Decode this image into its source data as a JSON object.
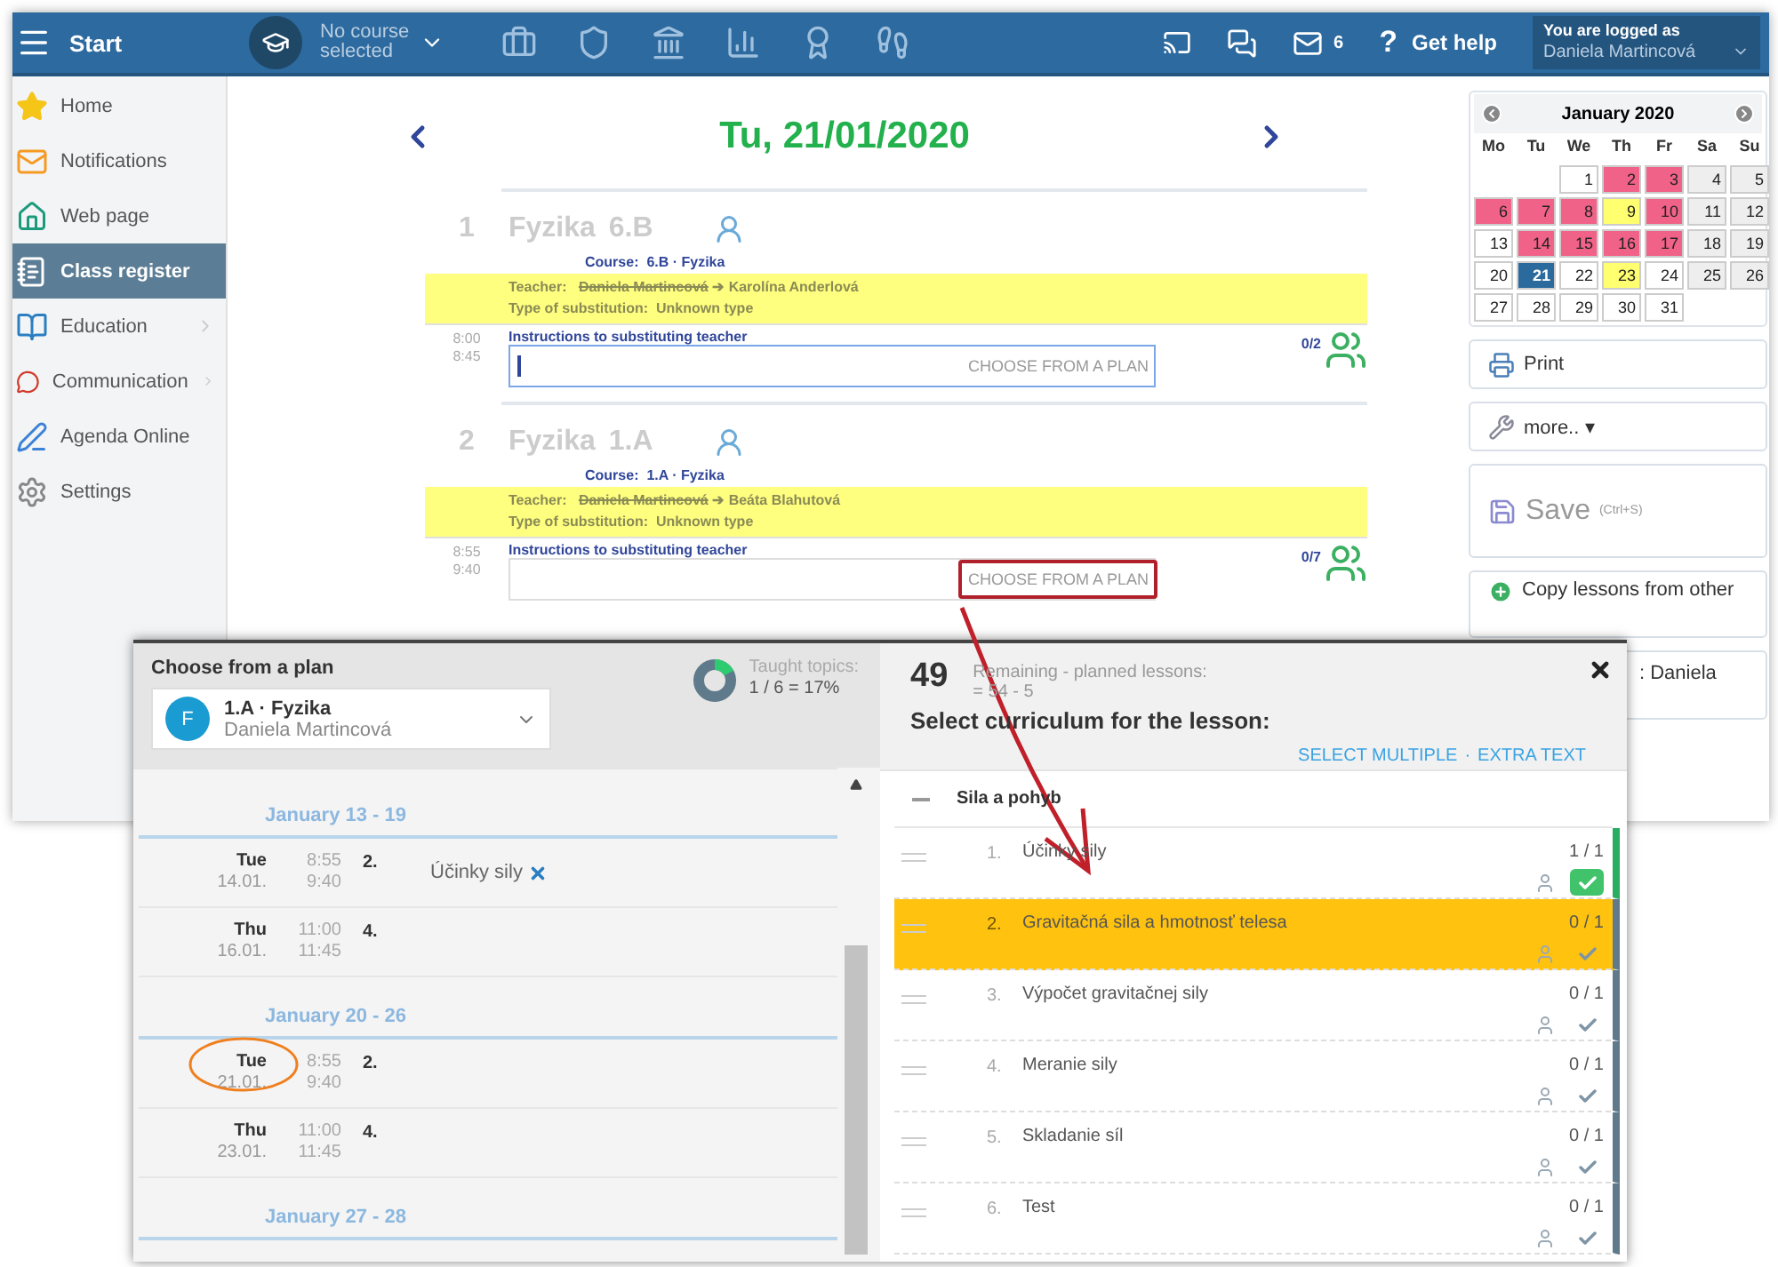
{
  "topbar": {
    "start": "Start",
    "course": [
      "No course",
      "selected"
    ],
    "mail_count": "6",
    "help_mark": "?",
    "help": "Get help",
    "user_caption": "You are logged as",
    "user_name": "Daniela Martincová"
  },
  "sidebar": {
    "items": [
      {
        "label": "Home",
        "selected": false,
        "has_submenu": false
      },
      {
        "label": "Notifications",
        "selected": false,
        "has_submenu": false
      },
      {
        "label": "Web page",
        "selected": false,
        "has_submenu": false
      },
      {
        "label": "Class register",
        "selected": true,
        "has_submenu": false
      },
      {
        "label": "Education",
        "selected": false,
        "has_submenu": true
      },
      {
        "label": "Communication",
        "selected": false,
        "has_submenu": true
      },
      {
        "label": "Agenda Online",
        "selected": false,
        "has_submenu": false
      },
      {
        "label": "Settings",
        "selected": false,
        "has_submenu": false
      }
    ]
  },
  "date_title": "Tu, 21/01/2020",
  "lessons": [
    {
      "number": "1",
      "title": "Fyzika 6.B",
      "course_label": "Course:",
      "course": "6.B · Fyzika",
      "teacher_label": "Teacher:",
      "teacher_old": "Daniela Martincová",
      "arrow": "➔",
      "teacher_new": "Karolína Anderlová",
      "type_label": "Type of substitution:",
      "type": "Unknown type",
      "start": "8:00",
      "end": "8:45",
      "instructions_label": "Instructions to substituting teacher",
      "plan_button": "CHOOSE FROM A PLAN",
      "focused": true,
      "highlighted": false,
      "attendance": "0/2"
    },
    {
      "number": "2",
      "title": "Fyzika 1.A",
      "course_label": "Course:",
      "course": "1.A · Fyzika",
      "teacher_label": "Teacher:",
      "teacher_old": "Daniela Martincová",
      "arrow": "➔",
      "teacher_new": "Beáta Blahutová",
      "type_label": "Type of substitution:",
      "type": "Unknown type",
      "start": "8:55",
      "end": "9:40",
      "instructions_label": "Instructions to substituting teacher",
      "plan_button": "CHOOSE FROM A PLAN",
      "focused": false,
      "highlighted": true,
      "attendance": "0/7"
    }
  ],
  "calendar": {
    "month": "January 2020",
    "weekdays": [
      "Mo",
      "Tu",
      "We",
      "Th",
      "Fr",
      "Sa",
      "Su"
    ],
    "days": [
      {
        "kind": "blank"
      },
      {
        "kind": "blank"
      },
      {
        "kind": "day",
        "day": "1",
        "color": "#ffffff",
        "selected": false
      },
      {
        "kind": "day",
        "day": "2",
        "color": "#f06288",
        "selected": false
      },
      {
        "kind": "day",
        "day": "3",
        "color": "#f06288",
        "selected": false
      },
      {
        "kind": "day",
        "day": "4",
        "color": "#eeeeee",
        "selected": false
      },
      {
        "kind": "day",
        "day": "5",
        "color": "#eeeeee",
        "selected": false
      },
      {
        "kind": "day",
        "day": "6",
        "color": "#f06288",
        "selected": false
      },
      {
        "kind": "day",
        "day": "7",
        "color": "#f06288",
        "selected": false
      },
      {
        "kind": "day",
        "day": "8",
        "color": "#f06288",
        "selected": false
      },
      {
        "kind": "day",
        "day": "9",
        "color": "#ffff70",
        "selected": false
      },
      {
        "kind": "day",
        "day": "10",
        "color": "#f06288",
        "selected": false
      },
      {
        "kind": "day",
        "day": "11",
        "color": "#eeeeee",
        "selected": false
      },
      {
        "kind": "day",
        "day": "12",
        "color": "#eeeeee",
        "selected": false
      },
      {
        "kind": "day",
        "day": "13",
        "color": "#ffffff",
        "selected": false
      },
      {
        "kind": "day",
        "day": "14",
        "color": "#f06288",
        "selected": false
      },
      {
        "kind": "day",
        "day": "15",
        "color": "#f06288",
        "selected": false
      },
      {
        "kind": "day",
        "day": "16",
        "color": "#f06288",
        "selected": false
      },
      {
        "kind": "day",
        "day": "17",
        "color": "#f06288",
        "selected": false
      },
      {
        "kind": "day",
        "day": "18",
        "color": "#eeeeee",
        "selected": false
      },
      {
        "kind": "day",
        "day": "19",
        "color": "#eeeeee",
        "selected": false
      },
      {
        "kind": "day",
        "day": "20",
        "color": "#ffffff",
        "selected": false
      },
      {
        "kind": "day",
        "day": "21",
        "color": "#2b6a9d",
        "selected": true
      },
      {
        "kind": "day",
        "day": "22",
        "color": "#ffffff",
        "selected": false
      },
      {
        "kind": "day",
        "day": "23",
        "color": "#ffff70",
        "selected": false
      },
      {
        "kind": "day",
        "day": "24",
        "color": "#ffffff",
        "selected": false
      },
      {
        "kind": "day",
        "day": "25",
        "color": "#eeeeee",
        "selected": false
      },
      {
        "kind": "day",
        "day": "26",
        "color": "#eeeeee",
        "selected": false
      },
      {
        "kind": "day",
        "day": "27",
        "color": "#ffffff",
        "selected": false
      },
      {
        "kind": "day",
        "day": "28",
        "color": "#ffffff",
        "selected": false
      },
      {
        "kind": "day",
        "day": "29",
        "color": "#ffffff",
        "selected": false
      },
      {
        "kind": "day",
        "day": "30",
        "color": "#ffffff",
        "selected": false
      },
      {
        "kind": "day",
        "day": "31",
        "color": "#ffffff",
        "selected": false
      }
    ]
  },
  "actions": [
    {
      "kind": "print",
      "label": "Print",
      "disabled": false
    },
    {
      "kind": "more",
      "label": "more..",
      "caret": "▾",
      "disabled": false
    },
    {
      "kind": "save",
      "label": "Save",
      "shortcut": "(Ctrl+S)",
      "disabled": true
    },
    {
      "kind": "copy",
      "label": "Copy lessons from other",
      "disabled": false
    },
    {
      "kind": "teacher",
      "label": ": Daniela",
      "disabled": false
    }
  ],
  "popup": {
    "title": "Choose from a plan",
    "plan": {
      "avatar": "F",
      "course": "1.A · Fyzika",
      "teacher": "Daniela Martincová"
    },
    "taught": {
      "label": "Taught topics:",
      "value": "1 / 6 = 17%",
      "level": 0.17
    },
    "weeks": [
      {
        "label": "January 13 - 19",
        "lessons": [
          {
            "day": "Tue",
            "date": "14.01.",
            "start": "8:55",
            "end": "9:40",
            "period": "2.",
            "topic": "Účinky sily",
            "circled": false
          },
          {
            "day": "Thu",
            "date": "16.01.",
            "start": "11:00",
            "end": "11:45",
            "period": "4.",
            "circled": false
          }
        ]
      },
      {
        "label": "January 20 - 26",
        "lessons": [
          {
            "day": "Tue",
            "date": "21.01.",
            "start": "8:55",
            "end": "9:40",
            "period": "2.",
            "circled": true
          },
          {
            "day": "Thu",
            "date": "23.01.",
            "start": "11:00",
            "end": "11:45",
            "period": "4.",
            "circled": false
          }
        ]
      },
      {
        "label": "January 27 - 28"
      }
    ],
    "count": "49",
    "remaining": "Remaining - planned lessons:",
    "formula": "= 54 - 5",
    "heading": "Select curriculum for the lesson:",
    "links": [
      "SELECT MULTIPLE",
      "EXTRA TEXT"
    ],
    "link_separator": "·",
    "group": "Sila a pohyb",
    "topics": [
      {
        "number": "1.",
        "title": "Účinky sily",
        "count": "1 / 1",
        "done": true,
        "highlighted": false
      },
      {
        "number": "2.",
        "title": "Gravitačná sila a hmotnosť telesa",
        "count": "0 / 1",
        "done": false,
        "highlighted": true
      },
      {
        "number": "3.",
        "title": "Výpočet gravitačnej sily",
        "count": "0 / 1",
        "done": false,
        "highlighted": false
      },
      {
        "number": "4.",
        "title": "Meranie sily",
        "count": "0 / 1",
        "done": false,
        "highlighted": false
      },
      {
        "number": "5.",
        "title": "Skladanie síl",
        "count": "0 / 1",
        "done": false,
        "highlighted": false
      },
      {
        "number": "6.",
        "title": "Test",
        "count": "0 / 1",
        "done": false,
        "highlighted": false
      }
    ]
  }
}
